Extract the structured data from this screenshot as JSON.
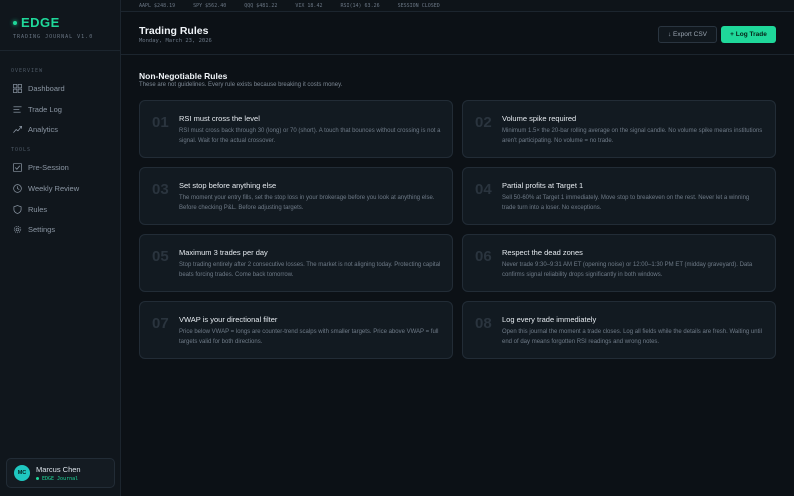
{
  "brand": {
    "name": "EDGE",
    "subtitle": "TRADING JOURNAL V1.0"
  },
  "sidebar": {
    "overview_label": "OVERVIEW",
    "overview_items": [
      {
        "label": "Dashboard",
        "icon": "grid-icon"
      },
      {
        "label": "Trade Log",
        "icon": "list-icon"
      },
      {
        "label": "Analytics",
        "icon": "trend-icon"
      }
    ],
    "tools_label": "TOOLS",
    "tools_items": [
      {
        "label": "Pre-Session",
        "icon": "checkbox-icon"
      },
      {
        "label": "Weekly Review",
        "icon": "clock-icon"
      },
      {
        "label": "Rules",
        "icon": "shield-icon"
      },
      {
        "label": "Settings",
        "icon": "gear-icon"
      }
    ]
  },
  "user": {
    "initials": "MC",
    "name": "Marcus Chen",
    "subtitle": "EDGE Journal"
  },
  "ticker": [
    "AAPL $248.19",
    "SPY $562.40",
    "QQQ $481.22",
    "VIX 18.42",
    "RSI(14) 63.26",
    "SESSION CLOSED"
  ],
  "header": {
    "title": "Trading Rules",
    "date": "Monday, March 23, 2026",
    "export_label": "↓ Export CSV",
    "log_label": "+ Log Trade"
  },
  "section": {
    "title": "Non-Negotiable Rules",
    "subtitle": "These are not guidelines. Every rule exists because breaking it costs money."
  },
  "rules": [
    {
      "num": "01",
      "title": "RSI must cross the level",
      "body": "RSI must cross back through 30 (long) or 70 (short). A touch that bounces without crossing is not a signal. Wait for the actual crossover."
    },
    {
      "num": "02",
      "title": "Volume spike required",
      "body": "Minimum 1.5× the 20-bar rolling average on the signal candle. No volume spike means institutions aren't participating. No volume = no trade."
    },
    {
      "num": "03",
      "title": "Set stop before anything else",
      "body": "The moment your entry fills, set the stop loss in your brokerage before you look at anything else. Before checking P&L. Before adjusting targets."
    },
    {
      "num": "04",
      "title": "Partial profits at Target 1",
      "body": "Sell 50-60% at Target 1 immediately. Move stop to breakeven on the rest. Never let a winning trade turn into a loser. No exceptions."
    },
    {
      "num": "05",
      "title": "Maximum 3 trades per day",
      "body": "Stop trading entirely after 2 consecutive losses. The market is not aligning today. Protecting capital beats forcing trades. Come back tomorrow."
    },
    {
      "num": "06",
      "title": "Respect the dead zones",
      "body": "Never trade 9:30–9:31 AM ET (opening noise) or 12:00–1:30 PM ET (midday graveyard). Data confirms signal reliability drops significantly in both windows."
    },
    {
      "num": "07",
      "title": "VWAP is your directional filter",
      "body": "Price below VWAP = longs are counter-trend scalps with smaller targets. Price above VWAP = full targets valid for both directions."
    },
    {
      "num": "08",
      "title": "Log every trade immediately",
      "body": "Open this journal the moment a trade closes. Log all fields while the details are fresh. Waiting until end of day means forgotten RSI readings and wrong notes."
    }
  ]
}
